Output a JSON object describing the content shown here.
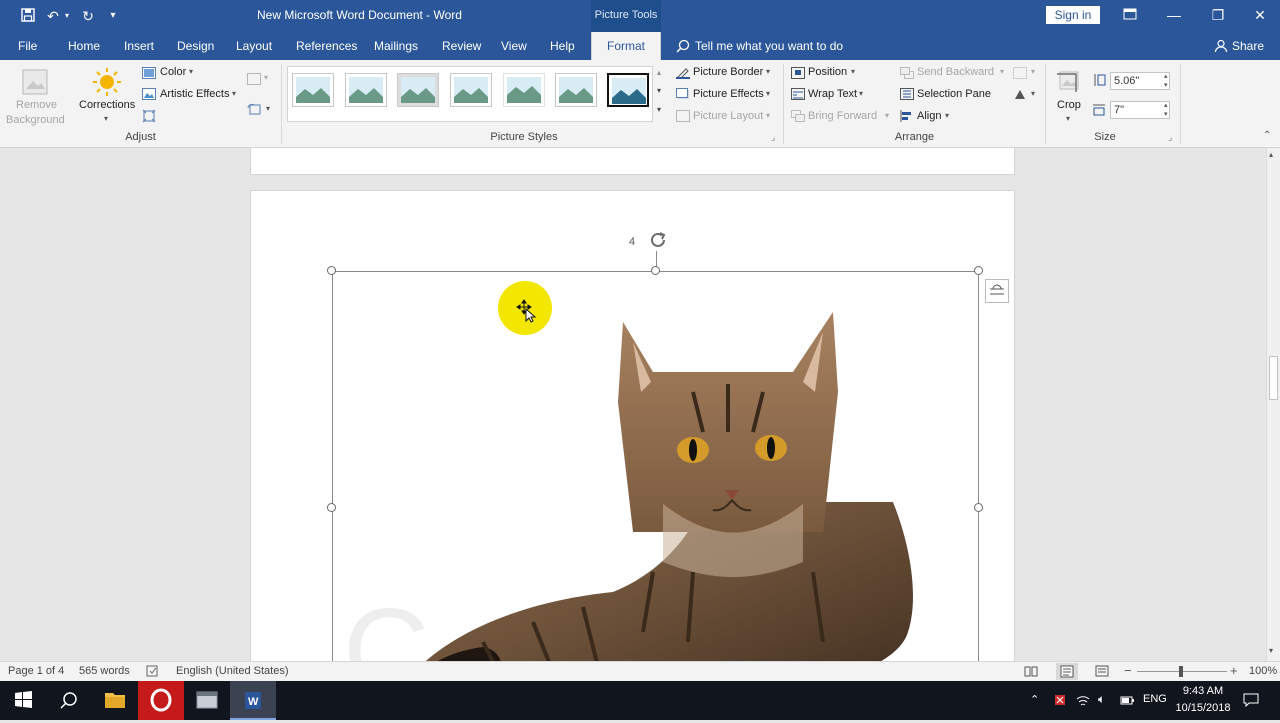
{
  "title_bar": {
    "document_title": "New Microsoft Word Document  -  Word",
    "picture_tools": "Picture Tools",
    "sign_in": "Sign in"
  },
  "tabs": {
    "file": "File",
    "home": "Home",
    "insert": "Insert",
    "design": "Design",
    "layout": "Layout",
    "references": "References",
    "mailings": "Mailings",
    "review": "Review",
    "view": "View",
    "help": "Help",
    "format": "Format",
    "tell_me": "Tell me what you want to do",
    "share": "Share"
  },
  "ribbon": {
    "adjust": {
      "remove_background_line1": "Remove",
      "remove_background_line2": "Background",
      "corrections": "Corrections",
      "color": "Color",
      "artistic_effects": "Artistic Effects",
      "group_name": "Adjust"
    },
    "picture_styles": {
      "group_name": "Picture Styles",
      "picture_border": "Picture Border",
      "picture_effects": "Picture Effects",
      "picture_layout": "Picture Layout"
    },
    "arrange": {
      "position": "Position",
      "wrap_text": "Wrap Text",
      "bring_forward": "Bring Forward",
      "send_backward": "Send Backward",
      "selection_pane": "Selection Pane",
      "align": "Align",
      "group_name": "Arrange"
    },
    "size": {
      "crop": "Crop",
      "height": "5.06\"",
      "width": "7\"",
      "group_name": "Size"
    }
  },
  "document": {
    "page_number_label": "4"
  },
  "status_bar": {
    "page": "Page 1 of 4",
    "words": "565 words",
    "language": "English (United States)",
    "zoom": "100%"
  },
  "taskbar": {
    "language": "ENG",
    "time": "9:43 AM",
    "date": "10/15/2018"
  },
  "colors": {
    "word_blue": "#2b579a",
    "ribbon_bg": "#f3f3f3",
    "taskbar_bg": "#11151e",
    "highlight_yellow": "#f3e600"
  }
}
